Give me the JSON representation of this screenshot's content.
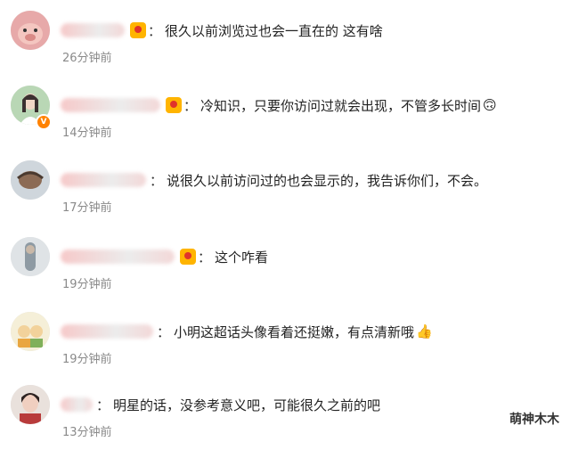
{
  "comments": [
    {
      "text": "很久以前浏览过也会一直在的 这有啥",
      "time": "26分钟前",
      "avatar": "pig-avatar"
    },
    {
      "text": "冷知识，只要你访问过就会出现，不管多长时间",
      "time": "14分钟前",
      "avatar": "girl-avatar",
      "emoji": "🙃"
    },
    {
      "text": "说很久以前访问过的也会显示的，我告诉你们，不会。",
      "time": "17分钟前",
      "avatar": "sketch-avatar"
    },
    {
      "text": "这个咋看",
      "time": "19分钟前",
      "avatar": "figure-avatar"
    },
    {
      "text": "小明这超话头像看着还挺嫩，有点清新哦",
      "time": "19分钟前",
      "avatar": "cartoon-avatar",
      "emoji": "👍"
    },
    {
      "text": "明星的话，没参考意义吧，可能很久之前的吧",
      "time": "13分钟前",
      "avatar": "photo-avatar"
    }
  ],
  "watermark": "萌神木木",
  "colors": {
    "accent": "#ff8200",
    "time": "#8a8a8a",
    "badge": "#ffb400"
  }
}
